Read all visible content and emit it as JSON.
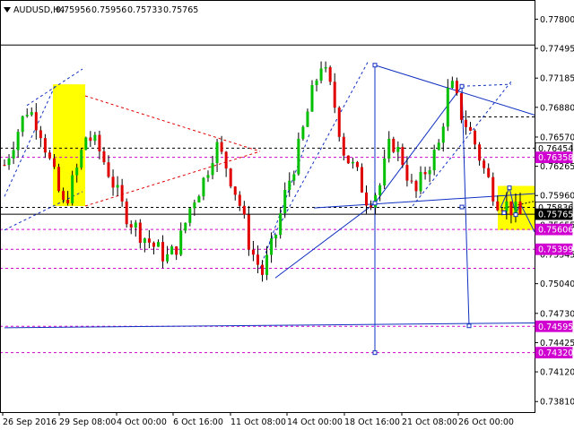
{
  "header": {
    "symbol_label": "AUDUSD,H4",
    "ohlc_values": [
      "0.75956",
      "0.75956",
      "0.75733",
      "0.75765"
    ]
  },
  "colors": {
    "bull": "#00c000",
    "bear": "#e00000",
    "wick": "#000000",
    "highlight": "#ffff00",
    "magenta_line": "#d000d0",
    "blue_line": "#1030c0",
    "black_line": "#000000",
    "price_tag": "#d000d0",
    "price_tag_text": "#ffffff",
    "level_tag_bg": "#ffffff"
  },
  "chart_data": {
    "type": "candlestick",
    "title": "AUDUSD,H4",
    "xlabel": "",
    "ylabel": "",
    "ylim": [
      0.737,
      0.78
    ],
    "y_ticks": [
      "0.77800",
      "0.77495",
      "0.77185",
      "0.76880",
      "0.76570",
      "0.76265",
      "0.75960",
      "0.75655",
      "0.75345",
      "0.75040",
      "0.74730",
      "0.74425",
      "0.74120",
      "0.73810"
    ],
    "x_ticks": [
      "26 Sep 2016",
      "29 Sep 08:00",
      "4 Oct 00:00",
      "6 Oct 16:00",
      "11 Oct 08:00",
      "14 Oct 00:00",
      "18 Oct 16:00",
      "21 Oct 08:00",
      "26 Oct 00:00"
    ],
    "bars_visible": 115,
    "close_path": [
      0.7628,
      0.766,
      0.7688,
      0.7668,
      0.7625,
      0.7585,
      0.7615,
      0.766,
      0.7645,
      0.7618,
      0.7585,
      0.7565,
      0.7552,
      0.754,
      0.753,
      0.755,
      0.759,
      0.7612,
      0.765,
      0.7625,
      0.759,
      0.754,
      0.7515,
      0.7548,
      0.76,
      0.764,
      0.769,
      0.7735,
      0.77,
      0.764,
      0.762,
      0.759,
      0.7605,
      0.7655,
      0.7632,
      0.7595,
      0.7625,
      0.7645,
      0.7715,
      0.768,
      0.7655,
      0.762,
      0.7592,
      0.7585,
      0.7575
    ],
    "horizontal_levels": [
      {
        "label": "0.76454",
        "value": 0.76454,
        "style": "dashed",
        "color": "#000000"
      },
      {
        "label": "0.76358",
        "value": 0.76358,
        "style": "dashed",
        "color": "#d000d0"
      },
      {
        "label": "0.75836",
        "value": 0.75836,
        "style": "dashed",
        "color": "#000000"
      },
      {
        "label": "0.75765",
        "value": 0.75765,
        "style": "solid",
        "color": "#000000"
      },
      {
        "label": "0.75606",
        "value": 0.75606,
        "style": "dashed",
        "color": "#d000d0"
      },
      {
        "label": "0.75399",
        "value": 0.75399,
        "style": "dashed",
        "color": "#d000d0"
      },
      {
        "label": "0.74595",
        "value": 0.74595,
        "style": "dashed",
        "color": "#d000d0"
      },
      {
        "label": "0.74320",
        "value": 0.7432,
        "style": "dashed",
        "color": "#d000d0"
      }
    ],
    "other_levels": [
      0.7753,
      0.7678,
      0.752
    ],
    "grid": false,
    "legend": "none"
  }
}
